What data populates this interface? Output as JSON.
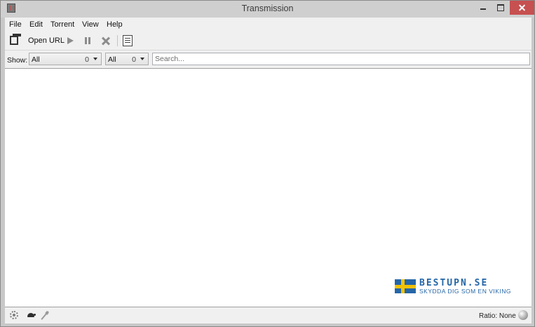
{
  "window": {
    "title": "Transmission"
  },
  "menu": {
    "items": [
      "File",
      "Edit",
      "Torrent",
      "View",
      "Help"
    ]
  },
  "toolbar": {
    "open_url_label": "Open URL",
    "icons": [
      "open-torrent-icon",
      "start-icon",
      "pause-icon",
      "remove-icon",
      "properties-icon"
    ]
  },
  "filter": {
    "show_label": "Show:",
    "activity": {
      "label": "All",
      "count": "0"
    },
    "tracker": {
      "label": "All",
      "count": "0"
    },
    "search_placeholder": "Search..."
  },
  "statusbar": {
    "ratio_text": "Ratio: None",
    "icons": [
      "preferences-icon",
      "turtle-icon",
      "network-icon",
      "ratio-icon"
    ]
  },
  "watermark": {
    "brand": "BESTUPN.SE",
    "tagline": "SKYDDA DIG SOM EN VIKING"
  },
  "colors": {
    "title_bar": "#cfcfcf",
    "close_button": "#c75050",
    "window_bg": "#f0f0f0",
    "list_bg": "#ffffff",
    "watermark_blue": "#2566a8",
    "watermark_yellow": "#f2c200"
  }
}
